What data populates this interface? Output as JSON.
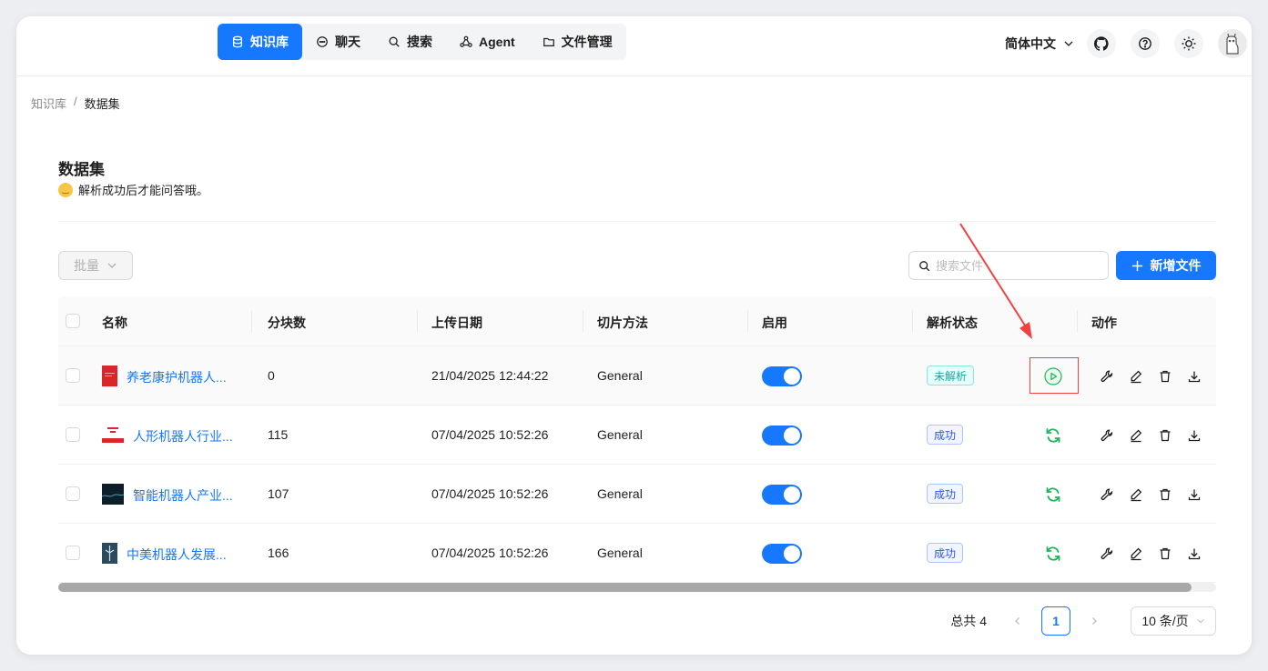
{
  "nav": [
    {
      "label": "知识库",
      "icon": "database-icon",
      "active": true
    },
    {
      "label": "聊天",
      "icon": "chat-icon",
      "active": false
    },
    {
      "label": "搜索",
      "icon": "search-icon",
      "active": false
    },
    {
      "label": "Agent",
      "icon": "agent-icon",
      "active": false
    },
    {
      "label": "文件管理",
      "icon": "folder-icon",
      "active": false
    }
  ],
  "header": {
    "language": "简体中文"
  },
  "breadcrumb": {
    "root": "知识库",
    "separator": "/",
    "current": "数据集"
  },
  "page": {
    "title": "数据集",
    "subtitle": "解析成功后才能问答哦。"
  },
  "toolbar": {
    "batch_label": "批量",
    "search_placeholder": "搜索文件",
    "add_label": "新增文件"
  },
  "table": {
    "columns": [
      "名称",
      "分块数",
      "上传日期",
      "切片方法",
      "启用",
      "解析状态",
      "动作"
    ],
    "rows": [
      {
        "name": "养老康护机器人...",
        "chunks": "0",
        "date": "21/04/2025 12:44:22",
        "method": "General",
        "enabled": true,
        "status": "未解析",
        "status_type": "unparsed",
        "run_icon": "play-icon"
      },
      {
        "name": "人形机器人行业...",
        "chunks": "115",
        "date": "07/04/2025 10:52:26",
        "method": "General",
        "enabled": true,
        "status": "成功",
        "status_type": "success",
        "run_icon": "refresh-icon"
      },
      {
        "name": "智能机器人产业...",
        "chunks": "107",
        "date": "07/04/2025 10:52:26",
        "method": "General",
        "enabled": true,
        "status": "成功",
        "status_type": "success",
        "run_icon": "refresh-icon"
      },
      {
        "name": "中美机器人发展...",
        "chunks": "166",
        "date": "07/04/2025 10:52:26",
        "method": "General",
        "enabled": true,
        "status": "成功",
        "status_type": "success",
        "run_icon": "refresh-icon"
      }
    ]
  },
  "pagination": {
    "total": "总共 4",
    "current": "1",
    "page_size": "10 条/页"
  },
  "colors": {
    "primary": "#1677ff",
    "success_green": "#22b35e",
    "annotation_red": "#f24141"
  }
}
